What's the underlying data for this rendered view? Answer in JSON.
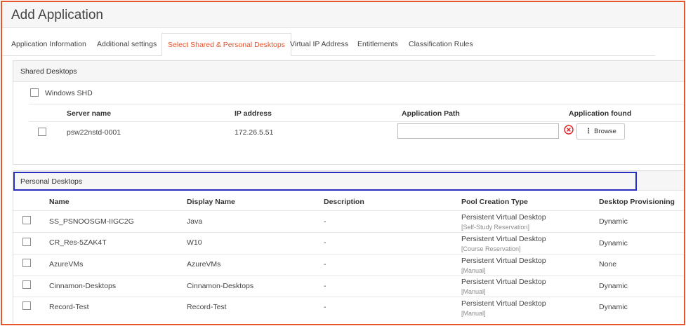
{
  "page": {
    "title": "Add Application"
  },
  "tabs": [
    {
      "label": "Application Information"
    },
    {
      "label": "Additional settings"
    },
    {
      "label": "Select Shared & Personal Desktops"
    },
    {
      "label": "Virtual IP Address"
    },
    {
      "label": "Entitlements"
    },
    {
      "label": "Classification Rules"
    }
  ],
  "active_tab": "Select Shared & Personal Desktops",
  "shared": {
    "title": "Shared Desktops",
    "group_label": "Windows SHD",
    "columns": [
      "Server name",
      "IP address",
      "Application Path",
      "Application found"
    ],
    "rows": [
      {
        "server": "psw22nstd-0001",
        "ip": "172.26.5.51",
        "path_value": "",
        "found_icon": "error-circle-icon",
        "browse_label": "Browse"
      }
    ]
  },
  "personal": {
    "title": "Personal Desktops",
    "columns": [
      "Name",
      "Display Name",
      "Description",
      "Pool Creation Type",
      "Desktop Provisioning"
    ],
    "rows": [
      {
        "name": "SS_PSNOOSGM-IIGC2G",
        "display": "Java",
        "desc": "-",
        "pool": "Persistent Virtual Desktop",
        "pool_sub": "[Self-Study Reservation]",
        "prov": "Dynamic"
      },
      {
        "name": "CR_Res-5ZAK4T",
        "display": "W10",
        "desc": "-",
        "pool": "Persistent Virtual Desktop",
        "pool_sub": "[Course Reservation]",
        "prov": "Dynamic"
      },
      {
        "name": "AzureVMs",
        "display": "AzureVMs",
        "desc": "-",
        "pool": "Persistent Virtual Desktop",
        "pool_sub": "[Manual]",
        "prov": "None"
      },
      {
        "name": "Cinnamon-Desktops",
        "display": "Cinnamon-Desktops",
        "desc": "-",
        "pool": "Persistent Virtual Desktop",
        "pool_sub": "[Manual]",
        "prov": "Dynamic"
      },
      {
        "name": "Record-Test",
        "display": "Record-Test",
        "desc": "-",
        "pool": "Persistent Virtual Desktop",
        "pool_sub": "[Manual]",
        "prov": "Dynamic"
      }
    ]
  },
  "colors": {
    "accent": "#e8542c",
    "highlight": "#2a2ec0",
    "error": "#e02020"
  }
}
